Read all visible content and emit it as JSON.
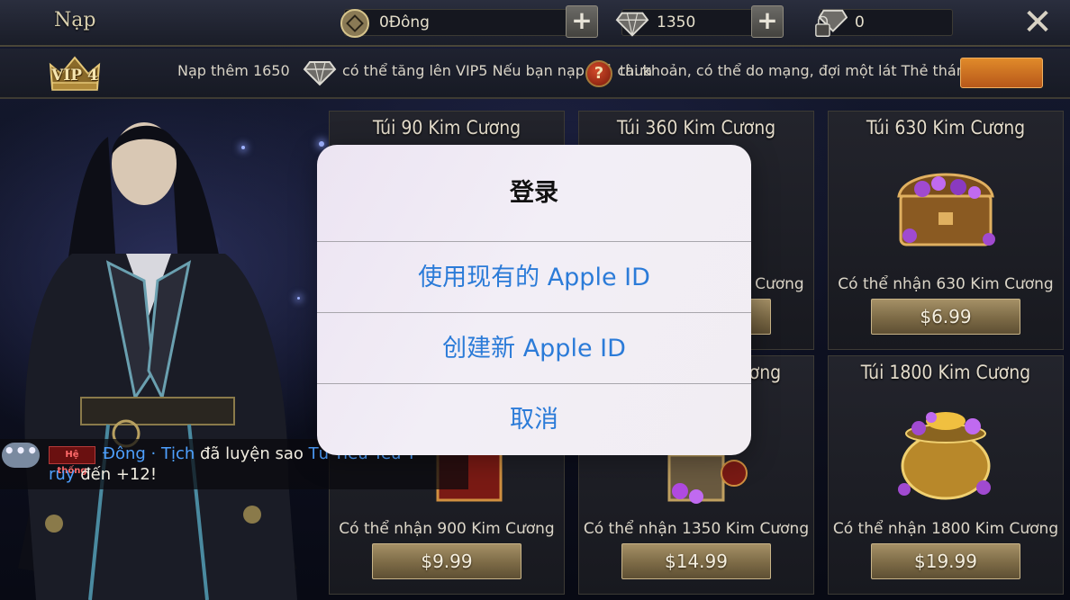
{
  "topbar": {
    "title": "Nạp",
    "currency": {
      "value": "0Đông",
      "icon": "coin-icon"
    },
    "diamonds": {
      "value": "1350",
      "icon": "diamond-icon"
    },
    "locked_diamonds": {
      "value": "0",
      "icon": "locked-diamond-icon"
    },
    "plus_label": "+",
    "close_label": "✕"
  },
  "vipbar": {
    "vip_label": "VIP 4",
    "notice_left": "Nạp thêm 1650",
    "notice_overlap": "có thể tăng lên VIP5 Nếu bạn nạp thẻ chưa",
    "help_label": "?",
    "notice_right": "tài khoản, có thể do mạng, đợi một lát Thẻ tháng nhận"
  },
  "cards": [
    {
      "title": "Túi 90 Kim Cương",
      "desc": "",
      "price": ""
    },
    {
      "title": "Túi 360 Kim Cương",
      "desc": "Có thể nhận 360 Kim Cương",
      "price": ""
    },
    {
      "title": "Túi 630 Kim Cương",
      "desc": "Có thể nhận 630 Kim Cương",
      "price": "$6.99"
    },
    {
      "title": "",
      "desc": "Có thể nhận 900 Kim Cương",
      "price": "$9.99"
    },
    {
      "title": "Túi 1350 Kim Cương",
      "desc": "Có thể nhận 1350 Kim Cương",
      "price": "$14.99"
    },
    {
      "title": "Túi 1800 Kim Cương",
      "desc": "Có thể nhận 1800 Kim Cương",
      "price": "$19.99"
    }
  ],
  "chat": {
    "tag": "Hệ thống",
    "name": "Đông · Tịch",
    "text1": "đã luyện sao",
    "item": "Tử Tiêu Yêu Y",
    "item2": "ruy",
    "text2": "đến +12!"
  },
  "alert": {
    "title": "登录",
    "btn_existing": "使用现有的 Apple ID",
    "btn_create": "创建新 Apple ID",
    "btn_cancel": "取消"
  },
  "colors": {
    "ios_blue": "#2b7bd8",
    "price_gold": "#a59066",
    "chat_blue": "#4ea0ff"
  }
}
